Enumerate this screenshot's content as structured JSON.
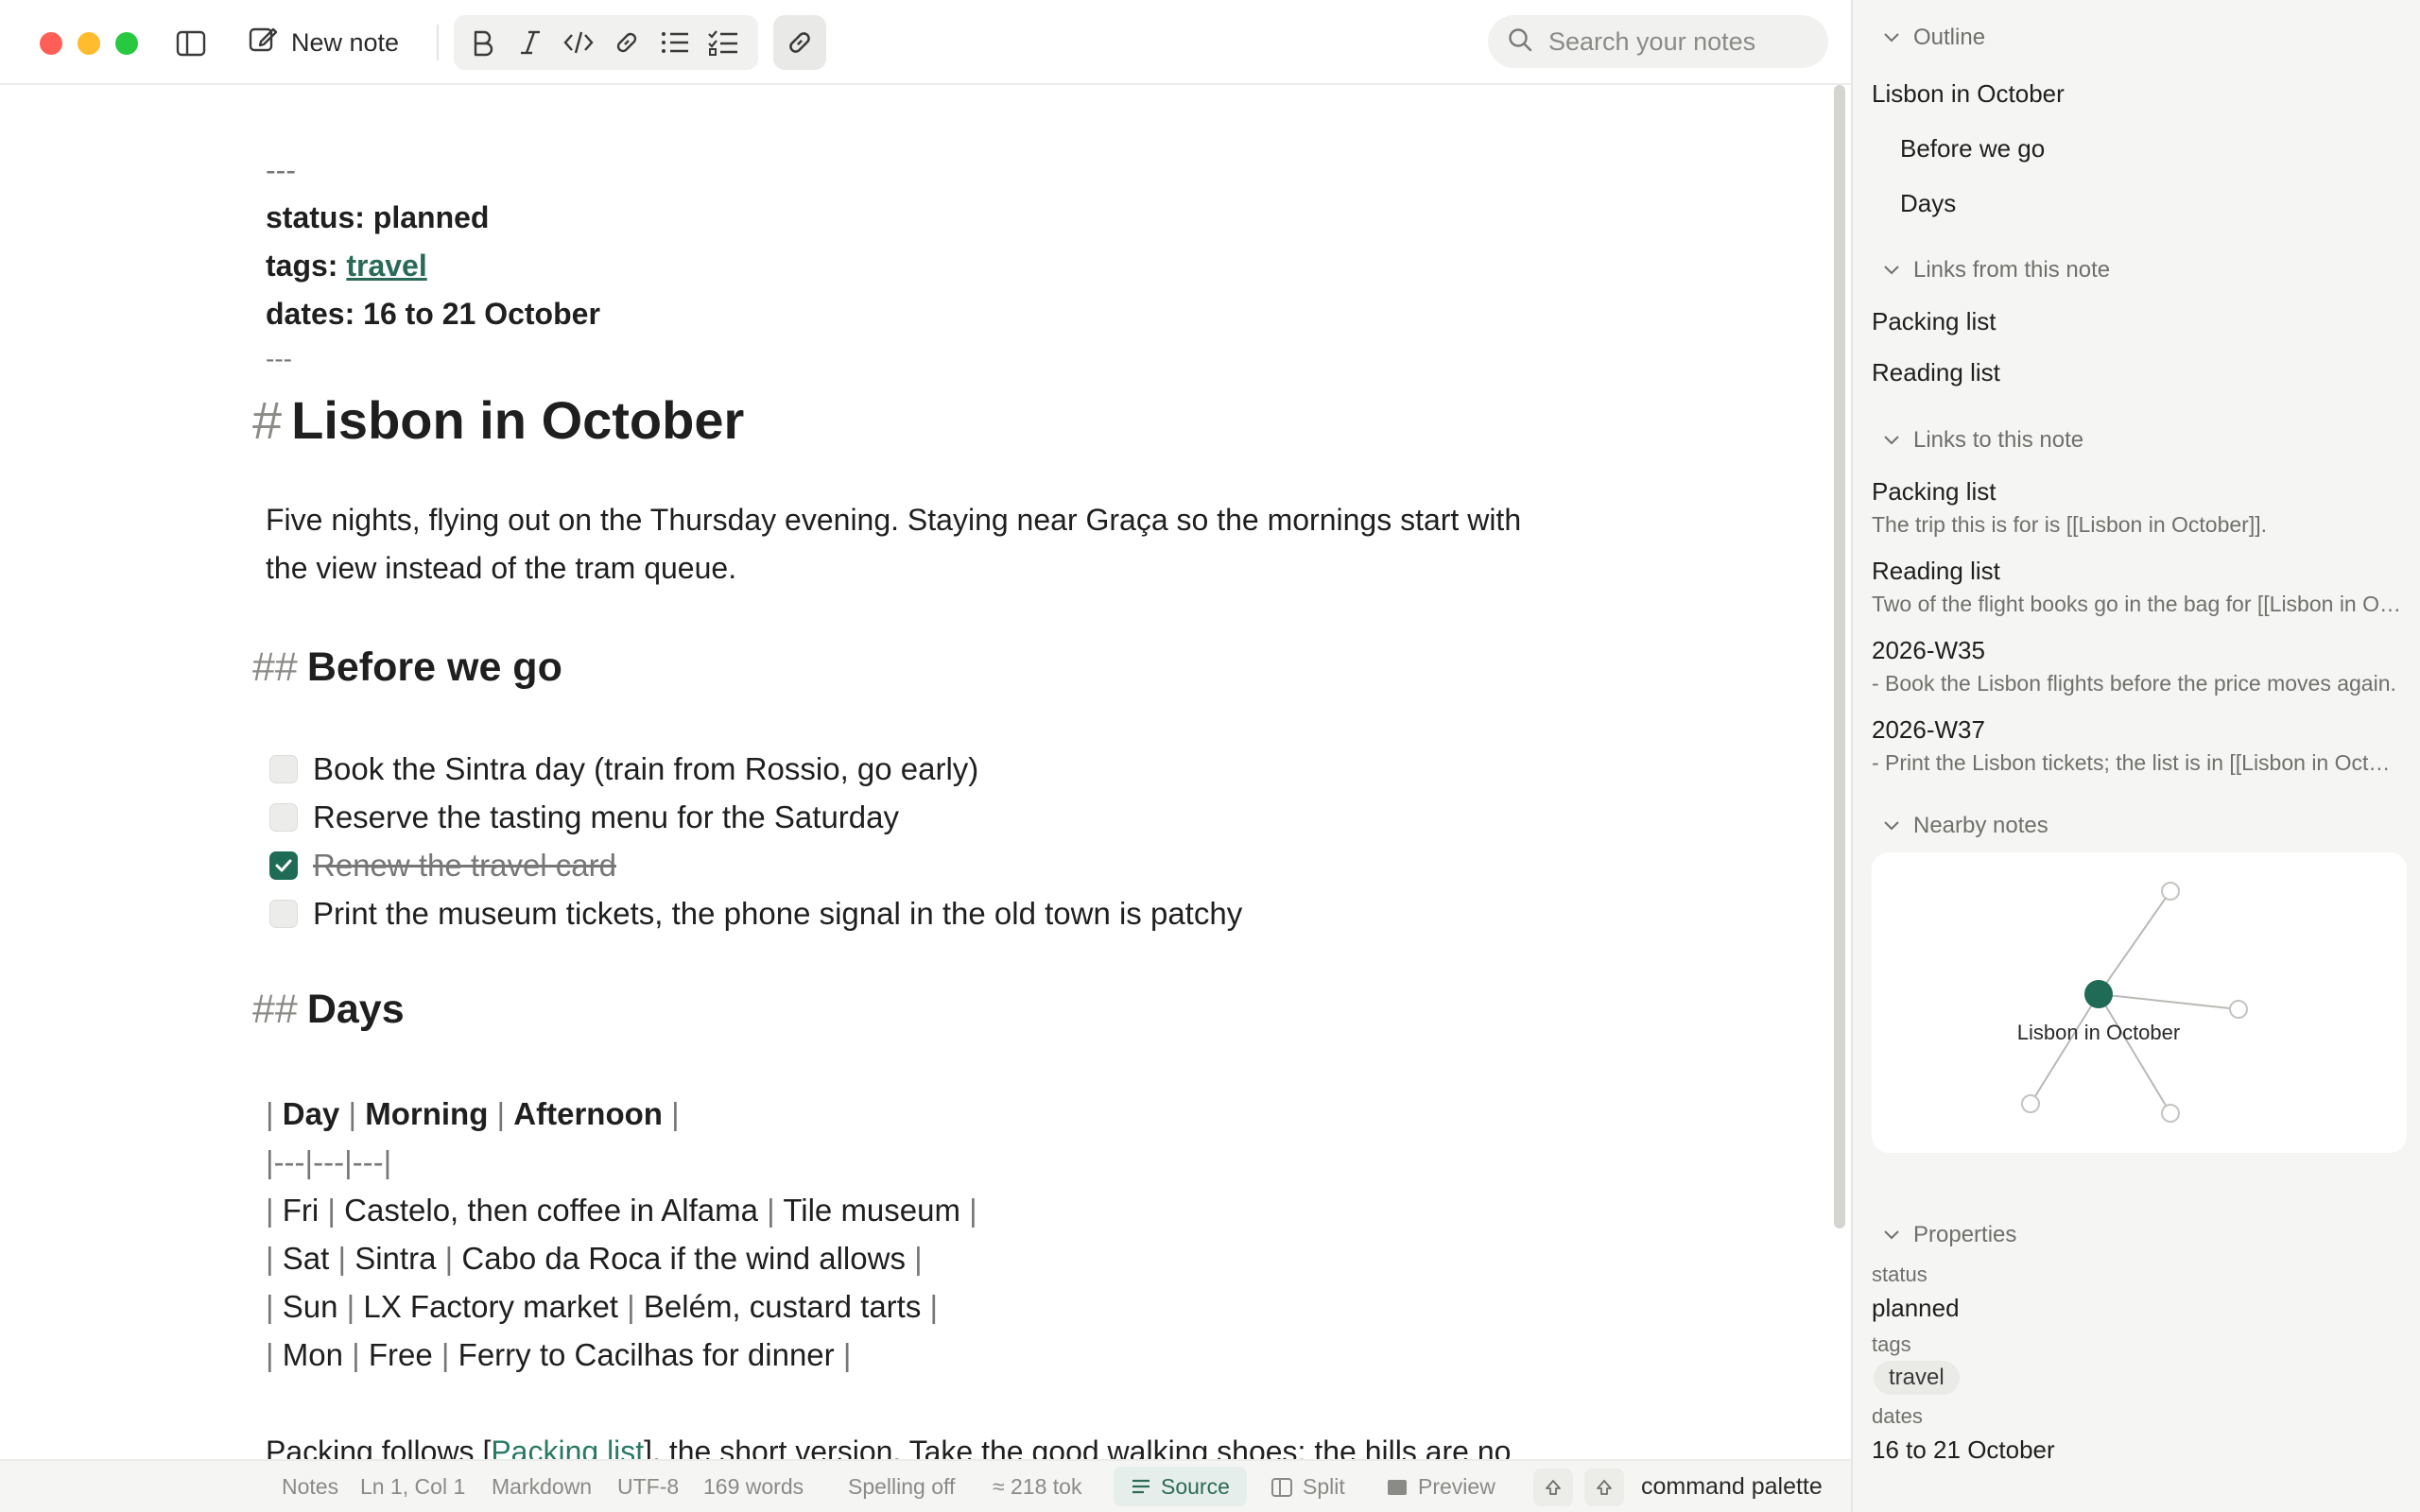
{
  "window": {
    "traffic_lights": {
      "close": "#ff5f57",
      "minimize": "#febc2e",
      "zoom": "#28c840"
    }
  },
  "toolbar": {
    "new_note_label": "New note",
    "format_buttons": [
      "bold-icon",
      "italic-icon",
      "code-icon",
      "link-icon",
      "bulleted-list-icon",
      "checklist-icon"
    ],
    "insert_link_icon": "link-icon",
    "search_placeholder": "Search your notes"
  },
  "note": {
    "frontmatter_open": "---",
    "status_line": "status: planned",
    "tags_key": "tags:",
    "tags_value": "travel",
    "dates_line": "dates: 16 to 21 October",
    "frontmatter_close": "---",
    "title_marker": "#",
    "title": "Lisbon in October",
    "intro_line_1": "Five nights, flying out on the Thursday evening. Staying near Graça so the mornings start with",
    "intro_line_2": "the view instead of the tram queue.",
    "section_marker": "##",
    "section_before": "Before we go",
    "tasks": [
      {
        "text": "Book the Sintra day (train from Rossio, go early)",
        "done": false
      },
      {
        "text": "Reserve the tasting menu for the Saturday",
        "done": false
      },
      {
        "text": "Renew the travel card",
        "done": true
      },
      {
        "text": "Print the museum tickets, the phone signal in the old town is patchy",
        "done": false
      }
    ],
    "section_days": "Days",
    "table": {
      "header": [
        "Day",
        "Morning",
        "Afternoon"
      ],
      "separator": "|---|---|---|",
      "rows": [
        [
          "Fri",
          "Castelo, then coffee in Alfama",
          "Tile museum"
        ],
        [
          "Sat",
          "Sintra",
          "Cabo da Roca if the wind allows"
        ],
        [
          "Sun",
          "LX Factory market",
          "Belém, custard tarts"
        ],
        [
          "Mon",
          "Free",
          "Ferry to Cacilhas for dinner"
        ]
      ]
    },
    "packing_prefix": "Packing follows [",
    "packing_link": "Packing list",
    "packing_suffix": "], the short version. Take the good walking shoes; the hills are no"
  },
  "statusbar": {
    "folder": "Notes",
    "position": "Ln 1, Col 1",
    "mode": "Markdown",
    "encoding": "UTF-8",
    "words": "169 words",
    "spelling": "Spelling off",
    "tokens": "≈ 218 tok",
    "view_source": "Source",
    "view_split": "Split",
    "view_preview": "Preview",
    "command_palette": "command palette",
    "accent": "#2a6b58"
  },
  "sidebar": {
    "outline_title": "Outline",
    "outline_items": [
      "Lisbon in October",
      "Before we go",
      "Days"
    ],
    "links_from_title": "Links from this note",
    "links_from": [
      "Packing list",
      "Reading list"
    ],
    "links_to_title": "Links to this note",
    "links_to": [
      {
        "title": "Packing list",
        "snippet": "The trip this is for is [[Lisbon in October]]."
      },
      {
        "title": "Reading list",
        "snippet": "Two of the flight books go in the bag for [[Lisbon in October]]."
      },
      {
        "title": "2026-W35",
        "snippet": "- Book the Lisbon flights before the price moves again."
      },
      {
        "title": "2026-W37",
        "snippet": "- Print the Lisbon tickets; the list is in [[Lisbon in October]]."
      }
    ],
    "nearby_title": "Nearby notes",
    "graph_center_label": "Lisbon in October",
    "properties_title": "Properties",
    "properties": {
      "status_key": "status",
      "status_value": "planned",
      "tags_key": "tags",
      "tags_value": "travel",
      "dates_key": "dates",
      "dates_value": "16 to 21 October"
    }
  }
}
